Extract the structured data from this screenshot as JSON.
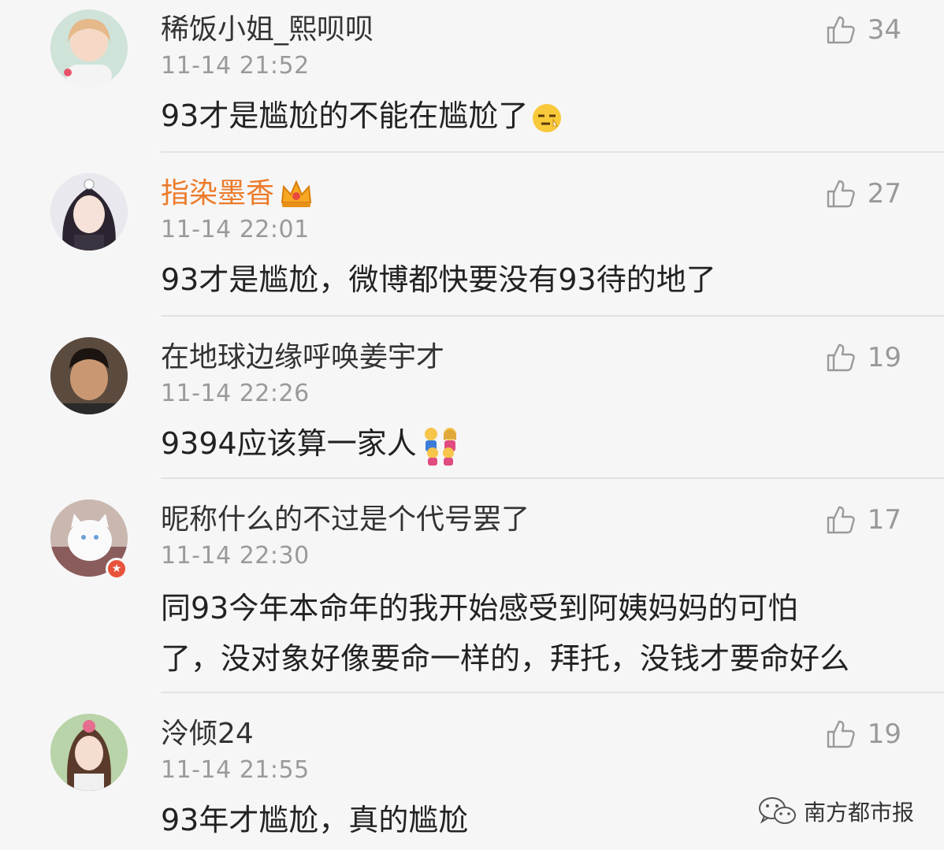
{
  "comments": [
    {
      "username": "稀饭小姐_熙呗呗",
      "time": "11-14 21:52",
      "likes": "34",
      "text_lines": [
        "93才是尴尬的不能在尴尬了"
      ],
      "vip": false,
      "emoji": "sleepy-face-emoji"
    },
    {
      "username": "指染墨香",
      "time": "11-14 22:01",
      "likes": "27",
      "text_lines": [
        "93才是尴尬，微博都快要没有93待的地了"
      ],
      "vip": true,
      "badge": "crown-icon"
    },
    {
      "username": "在地球边缘呼唤姜宇才",
      "time": "11-14 22:26",
      "likes": "19",
      "text_lines": [
        "9394应该算一家人"
      ],
      "vip": false,
      "emoji": "family-emoji"
    },
    {
      "username": "昵称什么的不过是个代号罢了",
      "time": "11-14 22:30",
      "likes": "17",
      "text_lines": [
        "同93今年本命年的我开始感受到阿姨妈妈的可怕",
        "了，没对象好像要命一样的，拜托，没钱才要命好么"
      ],
      "vip": false,
      "verified": true
    },
    {
      "username": "泠倾24",
      "time": "11-14 21:55",
      "likes": "19",
      "text_lines": [
        "93年才尴尬，真的尴尬"
      ],
      "vip": false
    }
  ],
  "watermark": {
    "label": "南方都市报",
    "icon": "wechat-icon"
  },
  "colors": {
    "background": "#f6f6f6",
    "vip_name": "#ec7b2a",
    "meta": "#9a9a9a"
  }
}
